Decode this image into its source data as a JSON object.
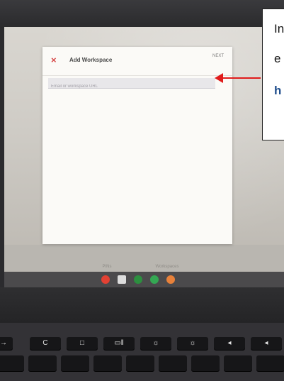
{
  "dialog": {
    "title": "Add Workspace",
    "next_label": "NEXT",
    "close_glyph": "×",
    "input_placeholder": "Email or workspace URL"
  },
  "app_bar": {
    "tabs": [
      "PINs",
      "Workspaces"
    ]
  },
  "shelf": {
    "icons": [
      {
        "name": "chrome-icon",
        "color": "#e34133"
      },
      {
        "name": "gmail-icon",
        "color": "#dddddd"
      },
      {
        "name": "drive-icon",
        "color": "#2c8f3f"
      },
      {
        "name": "play-store-icon",
        "color": "#34a853"
      },
      {
        "name": "app-icon",
        "color": "#e8813a"
      }
    ]
  },
  "keyboard": {
    "keys": [
      "→",
      "C",
      "□",
      "▭‖",
      "☼",
      "☼",
      "◂",
      "◂"
    ]
  },
  "callout": {
    "line1": "In",
    "line2": "e",
    "link": "h"
  },
  "colors": {
    "accent_red": "#e01b1b",
    "link_blue": "#1f4e8c",
    "close_red": "#d64545"
  }
}
